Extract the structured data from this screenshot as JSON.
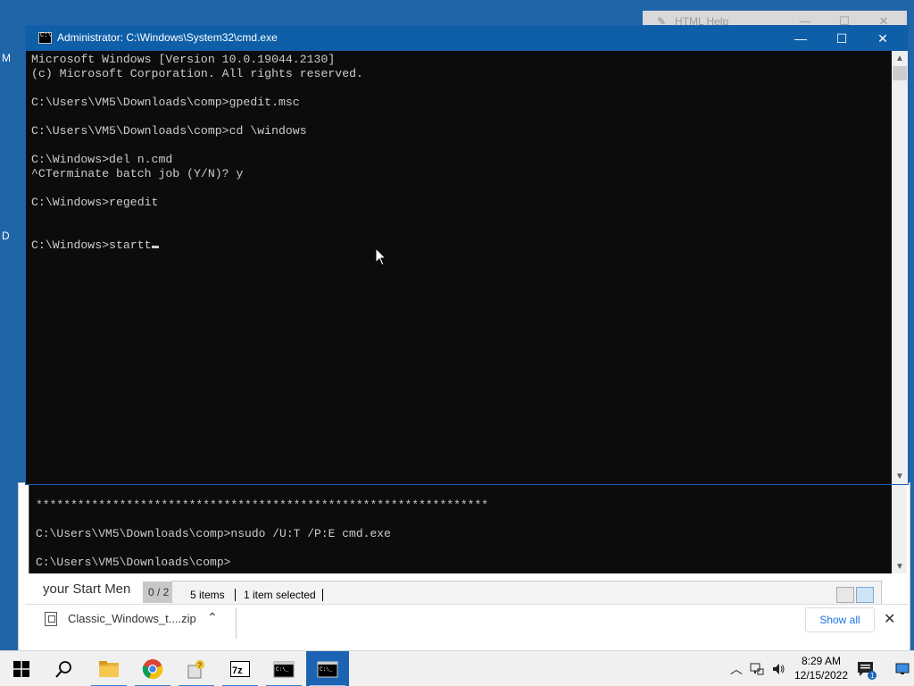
{
  "desktop": {
    "letters": [
      "M",
      "D"
    ]
  },
  "bg_window": {
    "title": "HTML Help",
    "icon": "help-icon"
  },
  "browser_page": {
    "text": "your Start Men",
    "counter": "0 / 2"
  },
  "explorer_status": {
    "items_count": "5 items",
    "selection": "1 item selected"
  },
  "console_behind": {
    "lines": [
      "*****************************************************************",
      "",
      "C:\\Users\\VM5\\Downloads\\comp>nsudo /U:T /P:E cmd.exe",
      "",
      "C:\\Users\\VM5\\Downloads\\comp>"
    ]
  },
  "download_bar": {
    "file_name": "Classic_Windows_t....zip",
    "show_all_label": "Show all"
  },
  "cmd": {
    "title": "Administrator:  C:\\Windows\\System32\\cmd.exe",
    "lines": [
      "Microsoft Windows [Version 10.0.19044.2130]",
      "(c) Microsoft Corporation. All rights reserved.",
      "",
      "C:\\Users\\VM5\\Downloads\\comp>gpedit.msc",
      "",
      "C:\\Users\\VM5\\Downloads\\comp>cd \\windows",
      "",
      "C:\\Windows>del n.cmd",
      "^CTerminate batch job (Y/N)? y",
      "",
      "C:\\Windows>regedit",
      "",
      ""
    ],
    "prompt_line": "C:\\Windows>startt"
  },
  "taskbar": {
    "items": [
      "start-icon",
      "search-icon",
      "file-explorer-icon",
      "chrome-icon",
      "nsudo-icon",
      "7zip-icon",
      "cmd-icon",
      "cmd-active-icon"
    ],
    "clock_time": "8:29 AM",
    "clock_date": "12/15/2022",
    "notification_count": "1"
  },
  "colors": {
    "desktop": "#1f65a8",
    "titlebar": "#0f5fa8",
    "console_bg": "#0c0c0c",
    "console_text": "#cccccc",
    "taskbar_active": "#1c64b3"
  }
}
